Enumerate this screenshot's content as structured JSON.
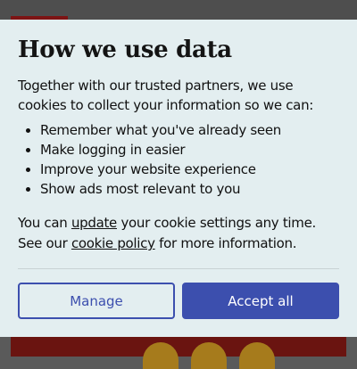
{
  "dialog": {
    "title": "How we use data",
    "intro": "Together with our trusted partners, we use cookies to collect your information so we can:",
    "benefits": [
      "Remember what you've already seen",
      "Make logging in easier",
      "Improve your website experience",
      "Show ads most relevant to you"
    ],
    "settings_text": {
      "part1": "You can ",
      "update_link": "update",
      "part2": " your cookie settings any time. See our ",
      "policy_link": "cookie policy",
      "part3": " for more information."
    },
    "buttons": {
      "manage": "Manage",
      "accept_all": "Accept all"
    }
  },
  "colors": {
    "dialog_background": "#e3eef0",
    "button_primary": "#3c4fae",
    "overlay": "#5a5a5a"
  }
}
